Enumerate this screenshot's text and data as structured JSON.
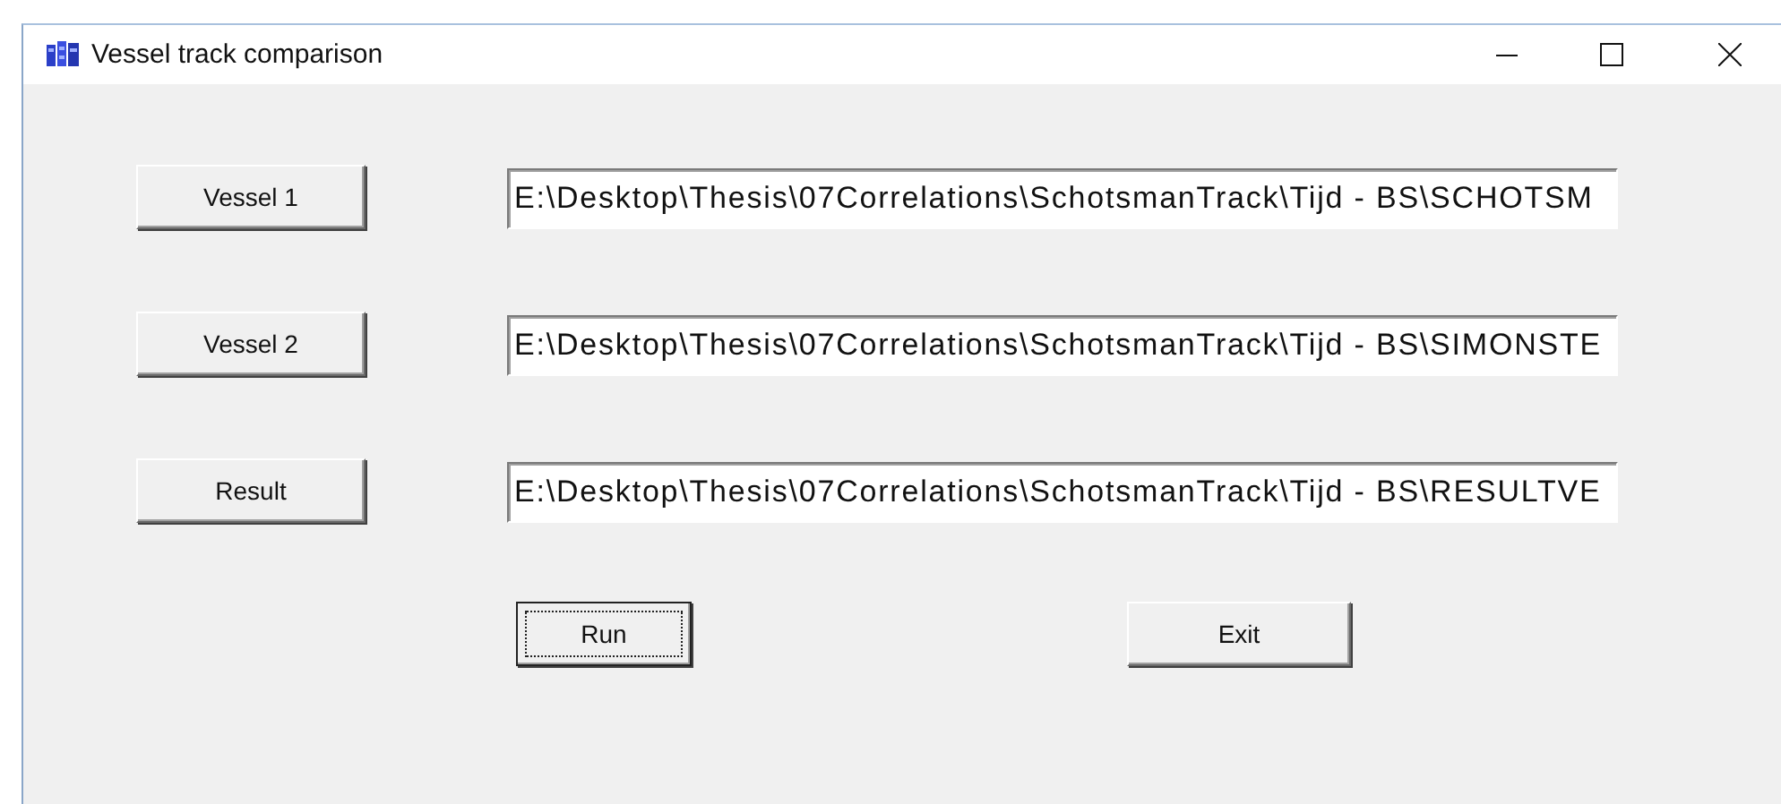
{
  "window": {
    "title": "Vessel track comparison"
  },
  "rows": [
    {
      "button": "Vessel 1",
      "path": "E:\\Desktop\\Thesis\\07Correlations\\SchotsmanTrack\\Tijd - BS\\SCHOTSM"
    },
    {
      "button": "Vessel 2",
      "path": "E:\\Desktop\\Thesis\\07Correlations\\SchotsmanTrack\\Tijd - BS\\SIMONSTE"
    },
    {
      "button": "Result",
      "path": "E:\\Desktop\\Thesis\\07Correlations\\SchotsmanTrack\\Tijd - BS\\RESULTVE"
    }
  ],
  "actions": [
    {
      "label": "Run",
      "focused": true
    },
    {
      "label": "Exit",
      "focused": false
    }
  ]
}
